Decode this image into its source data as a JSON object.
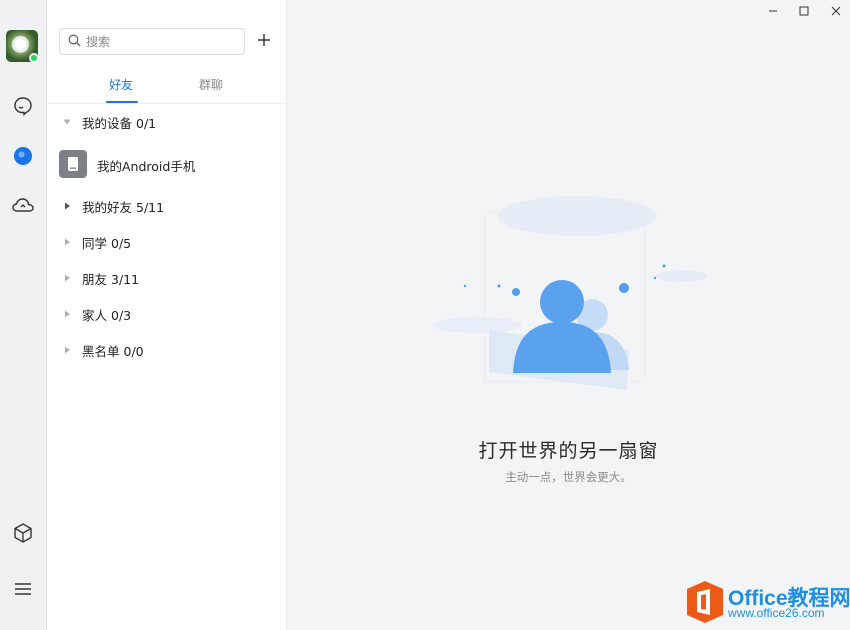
{
  "rail": {
    "status_color": "#2bd05d",
    "icons": [
      "chat-icon",
      "contacts-icon",
      "cloud-icon",
      "cube-icon",
      "menu-icon"
    ]
  },
  "search": {
    "placeholder": "搜索"
  },
  "tabs": [
    {
      "label": "好友",
      "active": true
    },
    {
      "label": "群聊",
      "active": false
    }
  ],
  "groups": [
    {
      "name": "我的设备",
      "count": "0/1",
      "expanded": true
    },
    {
      "name": "我的好友",
      "count": "5/11",
      "expanded": false
    },
    {
      "name": "同学",
      "count": "0/5",
      "expanded": false
    },
    {
      "name": "朋友",
      "count": "3/11",
      "expanded": false
    },
    {
      "name": "家人",
      "count": "0/3",
      "expanded": false
    },
    {
      "name": "黑名单",
      "count": "0/0",
      "expanded": false
    }
  ],
  "device": {
    "name": "我的Android手机"
  },
  "main": {
    "title": "打开世界的另一扇窗",
    "subtitle": "主动一点，世界会更大。"
  },
  "watermark": {
    "brand": "Office教程网",
    "url": "www.office26.com"
  },
  "colors": {
    "accent": "#1a75e8",
    "illustration": "#4f9cf0"
  }
}
